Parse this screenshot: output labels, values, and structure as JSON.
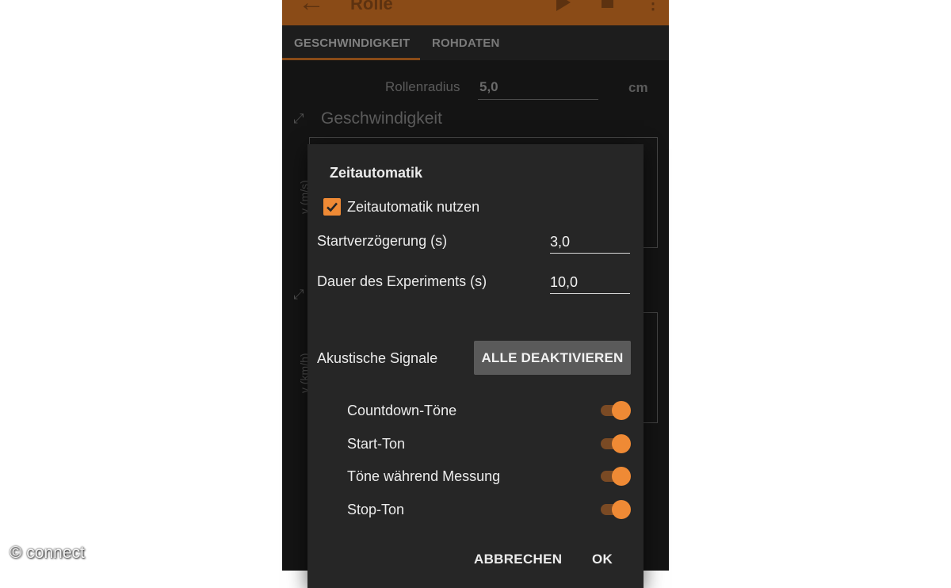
{
  "app_bar": {
    "title": "Rolle",
    "back_icon": "arrow-back-icon",
    "play_icon": "play-icon",
    "stop_icon": "stop-icon",
    "menu_icon": "more-vert-icon",
    "color": "#8a4b17"
  },
  "tabs": [
    {
      "label": "GESCHWINDIGKEIT",
      "active": true
    },
    {
      "label": "ROHDATEN",
      "active": false
    }
  ],
  "background": {
    "radius_label": "Rollenradius",
    "radius_value": "5,0",
    "radius_unit": "cm",
    "section_title": "Geschwindigkeit",
    "axis_label_1": "v (m/s)",
    "axis_label_2": "v (km/h)"
  },
  "dialog": {
    "title": "Zeitautomatik",
    "checkbox_label": "Zeitautomatik nutzen",
    "checkbox_checked": true,
    "start_delay_label": "Startverzögerung (s)",
    "start_delay_value": "3,0",
    "duration_label": "Dauer des Experiments (s)",
    "duration_value": "10,0",
    "acoustic_label": "Akustische Signale",
    "deactivate_all_label": "ALLE DEAKTIVIEREN",
    "toggles": [
      {
        "label": "Countdown-Töne",
        "on": true
      },
      {
        "label": "Start-Ton",
        "on": true
      },
      {
        "label": "Töne während Messung",
        "on": true
      },
      {
        "label": "Stop-Ton",
        "on": true
      }
    ],
    "cancel_label": "ABBRECHEN",
    "ok_label": "OK",
    "accent_color": "#ef8a35"
  },
  "watermark": "© connect"
}
